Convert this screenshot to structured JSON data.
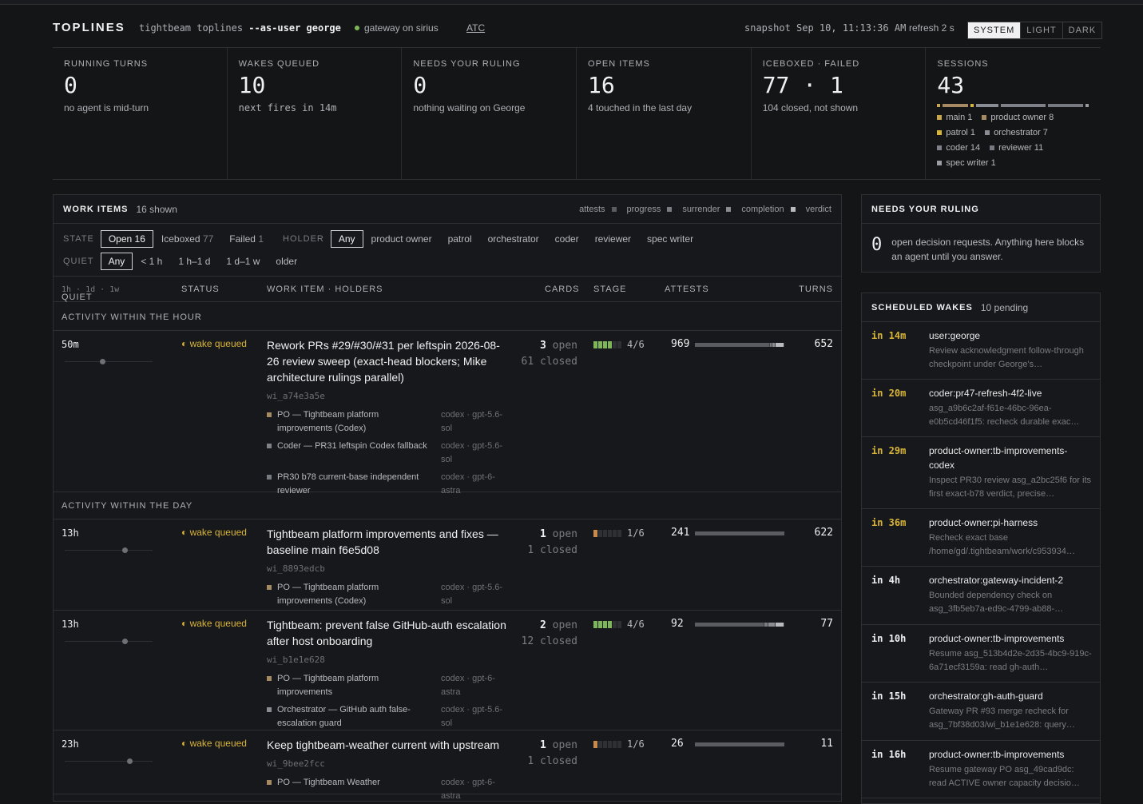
{
  "header": {
    "brand": "TOPLINES",
    "cmd_a": "tightbeam toplines ",
    "cmd_b": "--as-user george",
    "gateway": "gateway on sirius",
    "atc": "ATC",
    "snapshot": "snapshot Sep 10, 11:13:36 AM",
    "refresh": "refresh 2 s",
    "themes": [
      "SYSTEM",
      "LIGHT",
      "DARK"
    ],
    "theme_selected": "SYSTEM"
  },
  "stats": [
    {
      "label": "RUNNING TURNS",
      "value": "0",
      "sub": "no agent is mid-turn"
    },
    {
      "label": "WAKES QUEUED",
      "value": "10",
      "sub": "next fires  in 14m"
    },
    {
      "label": "NEEDS YOUR RULING",
      "value": "0",
      "sub": "nothing waiting on George"
    },
    {
      "label": "OPEN ITEMS",
      "value": "16",
      "sub": "4 touched in the last day"
    },
    {
      "label": "ICEBOXED · FAILED",
      "value": "77 · 1",
      "sub": "104 closed, not shown"
    },
    {
      "label": "SESSIONS",
      "value": "43",
      "sub": ""
    }
  ],
  "sessions": {
    "legend": [
      {
        "label": "main 1",
        "color": "#c9a64a"
      },
      {
        "label": "product owner 8",
        "color": "#a68a63"
      },
      {
        "label": "patrol 1",
        "color": "#d8b437"
      },
      {
        "label": "orchestrator 7",
        "color": "#8a8d93"
      },
      {
        "label": "coder 14",
        "color": "#7e8188"
      },
      {
        "label": "reviewer 11",
        "color": "#777a80"
      },
      {
        "label": "spec writer 1",
        "color": "#9a9ca1"
      }
    ]
  },
  "work": {
    "title": "WORK ITEMS",
    "count": "16 shown",
    "attests_label": "attests",
    "attests": [
      {
        "label": "progress",
        "color": "#5a5c61"
      },
      {
        "label": "surrender",
        "color": "#7a7c81"
      },
      {
        "label": "completion",
        "color": "#8a8c91"
      },
      {
        "label": "verdict",
        "color": "#b8babe"
      }
    ],
    "state_label": "STATE",
    "state_chips": [
      {
        "label": "Open",
        "n": "16",
        "on": true
      },
      {
        "label": "Iceboxed",
        "n": "77"
      },
      {
        "label": "Failed",
        "n": "1"
      }
    ],
    "holder_label": "HOLDER",
    "holders": [
      "Any",
      "product owner",
      "patrol",
      "orchestrator",
      "coder",
      "reviewer",
      "spec writer"
    ],
    "quiet_label": "QUIET",
    "quiet": [
      "Any",
      "< 1 h",
      "1 h–1 d",
      "1 d–1 w",
      "older"
    ],
    "cols": {
      "quiet": "QUIET",
      "quiet_scale": "1h · 1d · 1w",
      "status": "STATUS",
      "item": "WORK ITEM · HOLDERS",
      "cards": "CARDS",
      "stage": "STAGE",
      "attests": "ATTESTS",
      "turns": "TURNS"
    },
    "groups": [
      "ACTIVITY WITHIN THE HOUR",
      "ACTIVITY WITHIN THE DAY"
    ],
    "rows": [
      {
        "quiet": "50m",
        "status": "◐ wake queued",
        "title": "Rework PRs #29/#30/#31 per leftspin 2026-08-26 review sweep (exact-head blockers; Mike architecture rulings parallel)",
        "id": "wi_a74e3a5e",
        "holders": [
          {
            "n": "PO — Tightbeam platform improvements (Codex)",
            "m": "codex · gpt-5.6-sol",
            "c": "#a68a63"
          },
          {
            "n": "Coder — PR31 leftspin Codex fallback",
            "m": "codex · gpt-5.6-sol",
            "c": "#7e8188"
          },
          {
            "n": "PR30 b78 current-base independent reviewer",
            "m": "codex · gpt-6-astra",
            "c": "#777a80"
          }
        ],
        "open": "3",
        "open_l": " open",
        "closed": "61 closed",
        "stage": "4/6",
        "stage_n": 4,
        "stage_color": "#7fb55a",
        "attests": "969",
        "bar": [
          {
            "w": 0.84,
            "c": "#5a5c61"
          },
          {
            "w": 0.03,
            "c": "#7a7c81"
          },
          {
            "w": 0.03,
            "c": "#8a8c91"
          },
          {
            "w": 0.1,
            "c": "#b8babe"
          }
        ],
        "turns": "652"
      },
      {
        "quiet": "13h",
        "status": "◐ wake queued",
        "title": "Tightbeam platform improvements and fixes — baseline main f6e5d08",
        "id": "wi_8893edcb",
        "holders": [
          {
            "n": "PO — Tightbeam platform improvements (Codex)",
            "m": "codex · gpt-5.6-sol",
            "c": "#a68a63"
          }
        ],
        "open": "1",
        "open_l": " open",
        "closed": "1 closed",
        "stage": "1/6",
        "stage_n": 1,
        "stage_color": "#c98a4a",
        "attests": "241",
        "bar": [
          {
            "w": 1,
            "c": "#5a5c61"
          }
        ],
        "turns": "622"
      },
      {
        "quiet": "13h",
        "status": "◐ wake queued",
        "title": "Tightbeam: prevent false GitHub-auth escalation after host onboarding",
        "id": "wi_b1e1e628",
        "holders": [
          {
            "n": "PO — Tightbeam platform improvements",
            "m": "codex · gpt-6-astra",
            "c": "#a68a63"
          },
          {
            "n": "Orchestrator — GitHub auth false-escalation guard",
            "m": "codex · gpt-5.6-sol",
            "c": "#8a8d93"
          }
        ],
        "open": "2",
        "open_l": " open",
        "closed": "12 closed",
        "stage": "4/6",
        "stage_n": 4,
        "stage_color": "#7fb55a",
        "attests": "92",
        "bar": [
          {
            "w": 0.78,
            "c": "#5a5c61"
          },
          {
            "w": 0.04,
            "c": "#7a7c81"
          },
          {
            "w": 0.08,
            "c": "#8a8c91"
          },
          {
            "w": 0.1,
            "c": "#b8babe"
          }
        ],
        "turns": "77"
      },
      {
        "quiet": "23h",
        "status": "◐ wake queued",
        "title": "Keep tightbeam-weather current with upstream",
        "id": "wi_9bee2fcc",
        "holders": [
          {
            "n": "PO — Tightbeam Weather",
            "m": "codex · gpt-6-astra",
            "c": "#a68a63"
          }
        ],
        "open": "1",
        "open_l": " open",
        "closed": "1 closed",
        "stage": "1/6",
        "stage_n": 1,
        "stage_color": "#c98a4a",
        "attests": "26",
        "bar": [
          {
            "w": 1,
            "c": "#5a5c61"
          }
        ],
        "turns": "11"
      }
    ]
  },
  "ruling": {
    "title": "NEEDS YOUR RULING",
    "n": "0",
    "text": "open decision requests. Anything here blocks an agent until you answer."
  },
  "wakes": {
    "title": "SCHEDULED WAKES",
    "count": "10 pending",
    "items": [
      {
        "when": "in 14m",
        "target": "user:george",
        "desc": "Review acknowledgment follow-through checkpoint under George's…"
      },
      {
        "when": "in 20m",
        "target": "coder:pr47-refresh-4f2-live",
        "desc": "asg_a9b6c2af-f61e-46bc-96ea-e0b5cd46f1f5: recheck durable exac…"
      },
      {
        "when": "in 29m",
        "target": "product-owner:tb-improvements-codex",
        "desc": "Inspect PR30 review asg_a2bc25f6 for its first exact-b78 verdict, precise…"
      },
      {
        "when": "in 36m",
        "target": "product-owner:pi-harness",
        "desc": "Recheck exact base /home/gd/.tightbeam/work/c953934…"
      },
      {
        "when": "in 4h",
        "target": "orchestrator:gateway-incident-2",
        "desc": "Bounded dependency check on asg_3fb5eb7a-ed9c-4799-ab88-…"
      },
      {
        "when": "in 10h",
        "target": "product-owner:tb-improvements",
        "desc": "Resume asg_513b4d2e-2d35-4bc9-919c-6a71ecf3159a: read gh-auth…"
      },
      {
        "when": "in 15h",
        "target": "orchestrator:gh-auth-guard",
        "desc": "Gateway PR #93 merge recheck for asg_7bf38d03/wi_b1e1e628: query…"
      },
      {
        "when": "in 16h",
        "target": "product-owner:tb-improvements",
        "desc": "Resume gateway PO asg_49cad9dc: read ACTIVE owner capacity decisio…"
      }
    ]
  }
}
